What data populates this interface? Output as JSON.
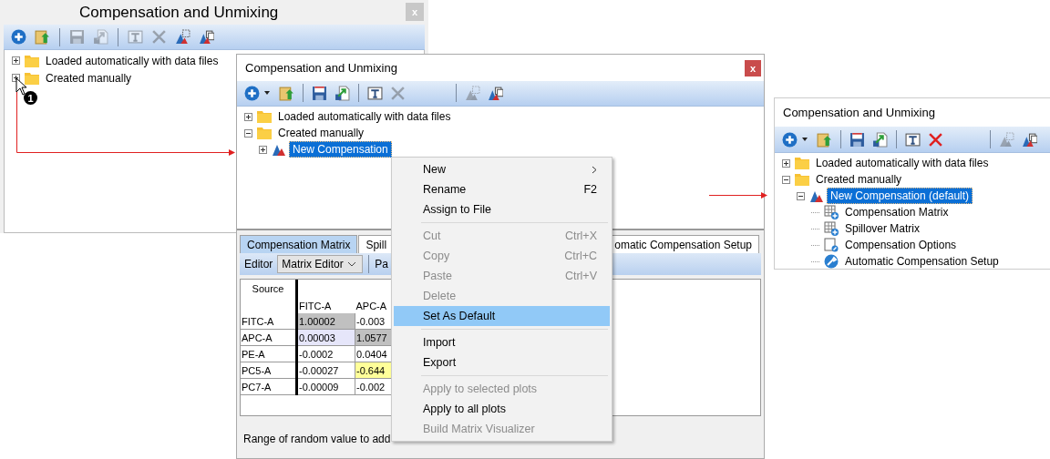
{
  "windows": [
    {
      "title": "Compensation and Unmixing",
      "close": "x",
      "toolbar": [
        {
          "kind": "add",
          "disabled": false
        },
        {
          "kind": "open",
          "disabled": false
        },
        {
          "kind": "separator"
        },
        {
          "kind": "save",
          "disabled": true
        },
        {
          "kind": "export",
          "disabled": true
        },
        {
          "kind": "separator"
        },
        {
          "kind": "rename",
          "disabled": true
        },
        {
          "kind": "delete",
          "disabled": true
        },
        {
          "kind": "plot",
          "disabled": false
        },
        {
          "kind": "copy-plot",
          "disabled": false
        }
      ],
      "tree": [
        {
          "label": "Loaded automatically with data files",
          "kind": "folder",
          "expanded": false,
          "selected": false
        },
        {
          "label": "Created manually",
          "kind": "folder",
          "expanded": false,
          "selected": false
        }
      ]
    },
    {
      "title": "Compensation and Unmixing",
      "close": "x",
      "toolbar": [
        {
          "kind": "add",
          "disabled": false,
          "dropdown": true
        },
        {
          "kind": "open",
          "disabled": false
        },
        {
          "kind": "separator"
        },
        {
          "kind": "save",
          "disabled": false
        },
        {
          "kind": "export",
          "disabled": false
        },
        {
          "kind": "separator"
        },
        {
          "kind": "rename",
          "disabled": false
        },
        {
          "kind": "delete",
          "disabled": true
        },
        {
          "kind": "spacer"
        },
        {
          "kind": "separator"
        },
        {
          "kind": "plot",
          "disabled": true
        },
        {
          "kind": "copy-plot",
          "disabled": false
        }
      ],
      "tree": [
        {
          "label": "Loaded automatically with data files",
          "kind": "folder",
          "expanded": false,
          "selected": false
        },
        {
          "label": "Created manually",
          "kind": "folder",
          "expanded": true,
          "selected": false,
          "children": [
            {
              "label": "New Compensation",
              "kind": "plot",
              "expanded": false,
              "selected": true
            }
          ]
        }
      ],
      "editor": {
        "tabs": [
          {
            "label": "Compensation Matrix",
            "selected": true
          },
          {
            "label": "Spill",
            "selected": false
          },
          {
            "label": "omatic Compensation Setup",
            "selected": false
          }
        ],
        "label": "Editor",
        "dropdown": "Matrix Editor",
        "cut_button": "Pa",
        "matrix": {
          "corner": "Source",
          "columns": [
            "FITC-A",
            "APC-A"
          ],
          "rows": [
            {
              "name": "FITC-A",
              "cells": [
                {
                  "text": "1.00002",
                  "kind": "diagonal"
                },
                {
                  "text": "-0.003",
                  "kind": "plain"
                }
              ]
            },
            {
              "name": "APC-A",
              "cells": [
                {
                  "text": "0.00003",
                  "kind": "edited"
                },
                {
                  "text": "1.0577",
                  "kind": "diagonal"
                }
              ]
            },
            {
              "name": "PE-A",
              "cells": [
                {
                  "text": "-0.0002",
                  "kind": "plain"
                },
                {
                  "text": "0.0404",
                  "kind": "plain"
                }
              ]
            },
            {
              "name": "PC5-A",
              "cells": [
                {
                  "text": "-0.00027",
                  "kind": "plain"
                },
                {
                  "text": "-0.644",
                  "kind": "warning"
                }
              ]
            },
            {
              "name": "PC7-A",
              "cells": [
                {
                  "text": "-0.00009",
                  "kind": "plain"
                },
                {
                  "text": "-0.002",
                  "kind": "plain"
                }
              ]
            }
          ]
        },
        "range_label": "Range of random value to add"
      }
    },
    {
      "title": "Compensation and Unmixing",
      "toolbar": [
        {
          "kind": "add",
          "disabled": false,
          "dropdown": true
        },
        {
          "kind": "open",
          "disabled": false
        },
        {
          "kind": "separator"
        },
        {
          "kind": "save",
          "disabled": false
        },
        {
          "kind": "export",
          "disabled": false
        },
        {
          "kind": "separator"
        },
        {
          "kind": "rename",
          "disabled": false
        },
        {
          "kind": "delete",
          "disabled": false
        },
        {
          "kind": "spacer"
        },
        {
          "kind": "separator"
        },
        {
          "kind": "plot",
          "disabled": true
        },
        {
          "kind": "copy-plot",
          "disabled": false
        }
      ],
      "tree": [
        {
          "label": "Loaded automatically with data files",
          "kind": "folder",
          "expanded": false,
          "selected": false
        },
        {
          "label": "Created manually",
          "kind": "folder",
          "expanded": true,
          "selected": false,
          "children": [
            {
              "label": "New Compensation (default)",
              "kind": "plot",
              "expanded": true,
              "selected": true,
              "children": [
                {
                  "label": "Compensation Matrix",
                  "kind": "matrix",
                  "selected": false
                },
                {
                  "label": "Spillover Matrix",
                  "kind": "matrix",
                  "selected": false
                },
                {
                  "label": "Compensation Options",
                  "kind": "options",
                  "selected": false
                },
                {
                  "label": "Automatic Compensation Setup",
                  "kind": "wrench",
                  "selected": false
                }
              ]
            }
          ]
        }
      ]
    }
  ],
  "context_menu": [
    {
      "label": "New",
      "disabled": false,
      "selected": false,
      "submenu": true
    },
    {
      "label": "Rename",
      "shortcut": "F2",
      "disabled": false,
      "selected": false
    },
    {
      "label": "Assign to File",
      "disabled": false,
      "selected": false,
      "separator_after": true
    },
    {
      "label": "Cut",
      "shortcut": "Ctrl+X",
      "disabled": true,
      "selected": false
    },
    {
      "label": "Copy",
      "shortcut": "Ctrl+C",
      "disabled": true,
      "selected": false
    },
    {
      "label": "Paste",
      "shortcut": "Ctrl+V",
      "disabled": true,
      "selected": false
    },
    {
      "label": "Delete",
      "disabled": true,
      "selected": false
    },
    {
      "label": "Set As Default",
      "disabled": false,
      "selected": true,
      "separator_after": true
    },
    {
      "label": "Import",
      "disabled": false,
      "selected": false
    },
    {
      "label": "Export",
      "disabled": false,
      "selected": false,
      "separator_after": true
    },
    {
      "label": "Apply to selected plots",
      "disabled": true,
      "selected": false
    },
    {
      "label": "Apply to all plots",
      "disabled": false,
      "selected": false
    },
    {
      "label": "Build Matrix Visualizer",
      "disabled": true,
      "selected": false
    }
  ],
  "step_badge": "1"
}
